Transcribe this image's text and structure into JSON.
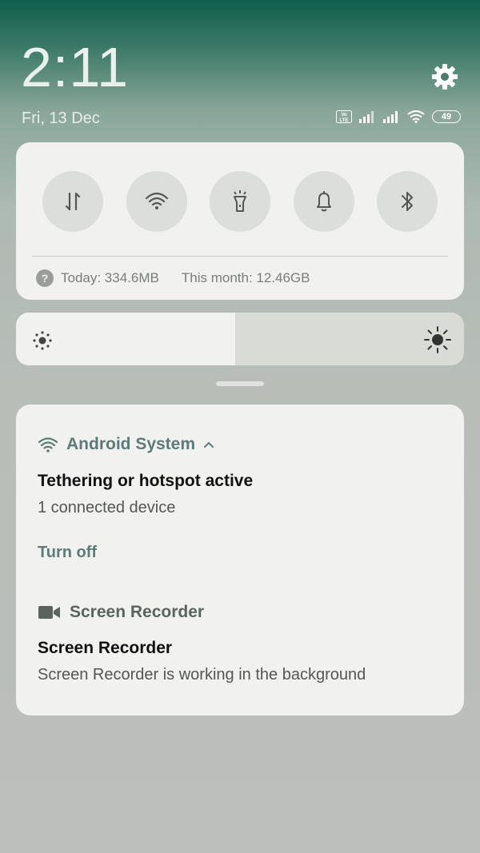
{
  "header": {
    "time": "2:11",
    "date": "Fri, 13 Dec",
    "battery_level": "49",
    "volte_label": "Vo LTE"
  },
  "quick_settings": {
    "toggles": [
      {
        "name": "mobile-data",
        "icon": "data-transfer-icon"
      },
      {
        "name": "wifi",
        "icon": "wifi-icon"
      },
      {
        "name": "flashlight",
        "icon": "flashlight-icon"
      },
      {
        "name": "sound",
        "icon": "bell-icon"
      },
      {
        "name": "bluetooth",
        "icon": "bluetooth-icon"
      }
    ],
    "usage_today": "Today: 334.6MB",
    "usage_month": "This month: 12.46GB"
  },
  "brightness": {
    "level_percent": 49
  },
  "notifications": {
    "hotspot": {
      "app_name": "Android System",
      "title": "Tethering or hotspot active",
      "text": "1 connected device",
      "action": "Turn off"
    },
    "recorder": {
      "app_name": "Screen Recorder",
      "title": "Screen Recorder",
      "text": "Screen Recorder is working in the background"
    }
  },
  "colors": {
    "accent": "#5e7a78",
    "panel": "#f1f2f0"
  }
}
